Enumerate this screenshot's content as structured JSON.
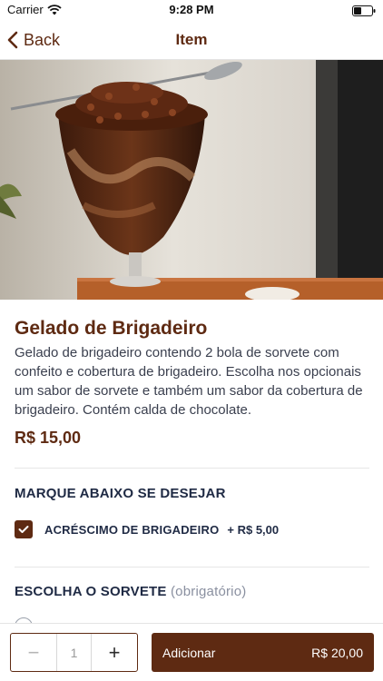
{
  "status_bar": {
    "carrier": "Carrier",
    "time": "9:28 PM"
  },
  "nav": {
    "back_label": "Back",
    "title": "Item"
  },
  "product": {
    "title": "Gelado de Brigadeiro",
    "description": "Gelado de brigadeiro contendo 2  bola de sorvete com confeito e cobertura de brigadeiro. Escolha nos opcionais um sabor de sorvete e também um sabor da cobertura de brigadeiro. Contém calda de chocolate.",
    "price": "R$ 15,00"
  },
  "extras": {
    "title": "MARQUE ABAIXO SE DESEJAR",
    "options": [
      {
        "label": "ACRÉSCIMO DE BRIGADEIRO",
        "price": "+ R$ 5,00",
        "checked": true
      }
    ]
  },
  "flavor_section": {
    "title": "ESCOLHA O SORVETE",
    "note": "(obrigatório)"
  },
  "footer": {
    "quantity": "1",
    "minus": "−",
    "plus": "+",
    "add_label": "Adicionar",
    "total": "R$ 20,00"
  },
  "colors": {
    "brand": "#5e2a12",
    "text": "#1f2a44",
    "muted": "#8a90a0"
  }
}
